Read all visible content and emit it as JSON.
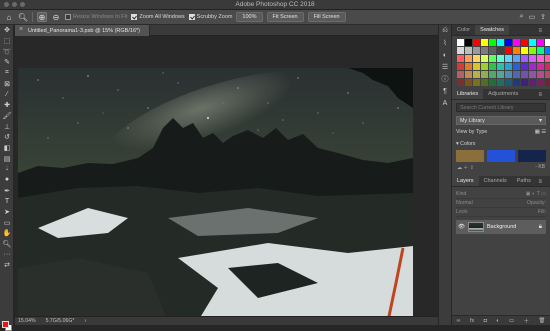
{
  "app": {
    "title": "Adobe Photoshop CC 2018"
  },
  "options": {
    "scroll_all_windows_label": "Resize Windows to Fit",
    "zoom_all_windows_label": "Zoom All Windows",
    "scrubby_zoom_label": "Scrubby Zoom",
    "zoom_100_label": "100%",
    "fit_screen_label": "Fit Screen",
    "fill_screen_label": "Fill Screen"
  },
  "document": {
    "tab_title": "Untitled_Panorama1-3.psb @ 15% (RGB/16*)",
    "close_glyph": "×"
  },
  "status": {
    "zoom": "15.04%",
    "size": "5.7G/5.06G*",
    "arrow": "›"
  },
  "panels": {
    "color_tab": "Color",
    "swatches_tab": "Swatches",
    "libraries_tab": "Libraries",
    "adjustments_tab": "Adjustments",
    "search_placeholder": "Search Current Library",
    "library_name": "My Library",
    "view_by": "View by Type",
    "colors_group": "Colors",
    "library_size": "- KB",
    "layers_tab": "Layers",
    "channels_tab": "Channels",
    "paths_tab": "Paths",
    "kind_label": "Kind",
    "normal_label": "Normal",
    "opacity_label": "Opacity:",
    "lock_label": "Lock:",
    "fill_label": "Fill:",
    "layer_name": "Background"
  },
  "swatches": [
    "#ffffff",
    "#000000",
    "#ff0000",
    "#ffff00",
    "#00ff00",
    "#00ffff",
    "#0000ff",
    "#ff00ff",
    "#ff0000",
    "#00ffff",
    "#ff00ff",
    "#ffffff",
    "#d8d8d8",
    "#bdbdbd",
    "#9a9a9a",
    "#7c7c7c",
    "#5f5f5f",
    "#404040",
    "#ff0000",
    "#ff8000",
    "#ffff00",
    "#80ff00",
    "#00ff80",
    "#0080ff",
    "#ff5f5f",
    "#ff9f5f",
    "#ffd65f",
    "#d6ff5f",
    "#5fff5f",
    "#5fffd6",
    "#5fd6ff",
    "#5f9fff",
    "#9f5fff",
    "#d65fff",
    "#ff5fd6",
    "#ff5f9f",
    "#d83a3a",
    "#e07a2e",
    "#d9c42c",
    "#9cd02c",
    "#2cc24b",
    "#2cc2a8",
    "#2c9ed0",
    "#2c62d0",
    "#5c2cd0",
    "#9c2cd0",
    "#d02ca0",
    "#d02c5c",
    "#b86060",
    "#c08a50",
    "#b8b050",
    "#8fb050",
    "#50a86a",
    "#50a898",
    "#508cb0",
    "#5068b0",
    "#7050b0",
    "#9850b0",
    "#b05090",
    "#b05068",
    "#7a3030",
    "#805020",
    "#7a7020",
    "#507020",
    "#207038",
    "#207060",
    "#205878",
    "#203c78",
    "#402078",
    "#602078",
    "#782060",
    "#782038"
  ],
  "library_colors": [
    "#8a6f3c",
    "#2351d8",
    "#15244a"
  ],
  "colors": {
    "fg": "#e01818",
    "bg": "#ffffff",
    "panel": "#424242"
  }
}
